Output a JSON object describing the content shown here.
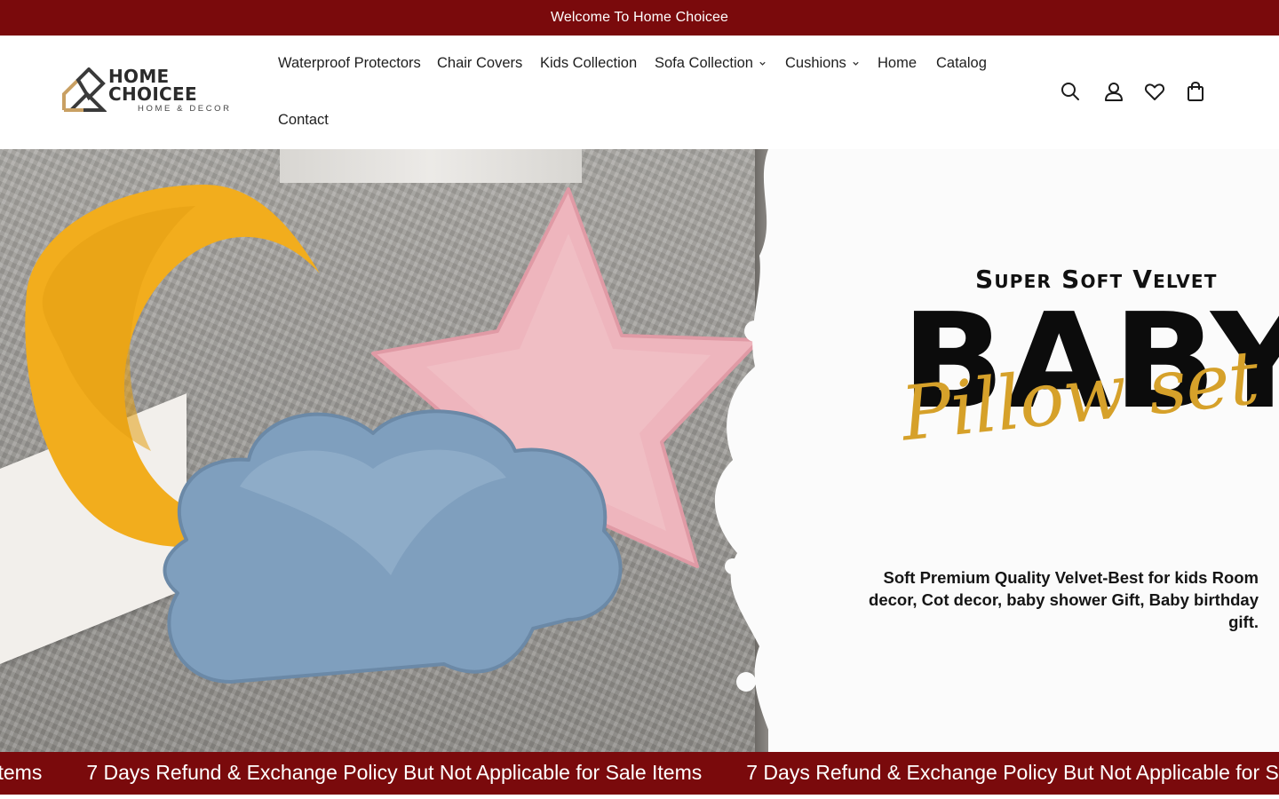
{
  "announcement": {
    "text": "Welcome To Home Choicee"
  },
  "brand": {
    "name": "HOME CHOICEE",
    "tagline": "HOME & DECOR",
    "colors": {
      "primary": "#7a0a0c",
      "logo_gold": "#c9a063",
      "logo_dark": "#3a3a3a"
    }
  },
  "nav": {
    "items": [
      {
        "label": "Waterproof Protectors",
        "has_dropdown": false
      },
      {
        "label": "Chair Covers",
        "has_dropdown": false
      },
      {
        "label": "Kids Collection",
        "has_dropdown": false
      },
      {
        "label": "Sofa Collection",
        "has_dropdown": true
      },
      {
        "label": "Cushions",
        "has_dropdown": true
      },
      {
        "label": "Home",
        "has_dropdown": false
      },
      {
        "label": "Catalog",
        "has_dropdown": false
      },
      {
        "label": "Contact",
        "has_dropdown": false
      }
    ]
  },
  "header_icons": [
    "search-icon",
    "account-icon",
    "wishlist-icon",
    "cart-icon"
  ],
  "hero": {
    "kicker": "Super Soft Velvet",
    "headline": "BABY",
    "script_title": "Pillow set",
    "description": "Soft Premium Quality Velvet-Best for kids Room decor, Cot decor, baby shower Gift, Baby birthday gift.",
    "colors": {
      "script": "#d6a12a",
      "moon": "#f2ad1d",
      "star": "#eeb5bd",
      "cloud": "#7f9fbe"
    }
  },
  "marquee": {
    "text": "7 Days Refund & Exchange Policy But Not Applicable for Sale Items",
    "lead_fragment": "ale Items"
  }
}
